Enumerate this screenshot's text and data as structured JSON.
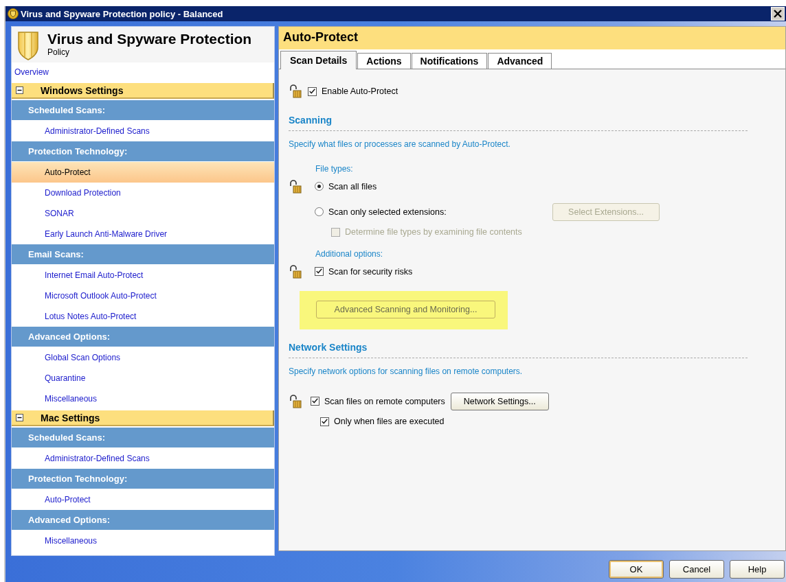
{
  "window": {
    "title": "Virus and Spyware Protection policy - Balanced"
  },
  "policy": {
    "title": "Virus and Spyware Protection",
    "subtitle": "Policy"
  },
  "sidebar": {
    "overview": "Overview",
    "groups": [
      {
        "label": "Windows Settings",
        "expanded": true,
        "sections": [
          {
            "label": "Scheduled Scans:",
            "items": [
              {
                "label": "Administrator-Defined Scans",
                "selected": false
              }
            ]
          },
          {
            "label": "Protection Technology:",
            "items": [
              {
                "label": "Auto-Protect",
                "selected": true
              },
              {
                "label": "Download Protection",
                "selected": false
              },
              {
                "label": "SONAR",
                "selected": false
              },
              {
                "label": "Early Launch Anti-Malware Driver",
                "selected": false
              }
            ]
          },
          {
            "label": "Email Scans:",
            "items": [
              {
                "label": "Internet Email Auto-Protect",
                "selected": false
              },
              {
                "label": "Microsoft Outlook Auto-Protect",
                "selected": false
              },
              {
                "label": "Lotus Notes Auto-Protect",
                "selected": false
              }
            ]
          },
          {
            "label": "Advanced Options:",
            "items": [
              {
                "label": "Global Scan Options",
                "selected": false
              },
              {
                "label": "Quarantine",
                "selected": false
              },
              {
                "label": "Miscellaneous",
                "selected": false
              }
            ]
          }
        ]
      },
      {
        "label": "Mac Settings",
        "expanded": true,
        "sections": [
          {
            "label": "Scheduled Scans:",
            "items": [
              {
                "label": "Administrator-Defined Scans",
                "selected": false
              }
            ]
          },
          {
            "label": "Protection Technology:",
            "items": [
              {
                "label": "Auto-Protect",
                "selected": false
              }
            ]
          },
          {
            "label": "Advanced Options:",
            "items": [
              {
                "label": "Miscellaneous",
                "selected": false
              }
            ]
          }
        ]
      }
    ]
  },
  "panel": {
    "title": "Auto-Protect",
    "tabs": [
      {
        "label": "Scan Details",
        "selected": true
      },
      {
        "label": "Actions",
        "selected": false
      },
      {
        "label": "Notifications",
        "selected": false
      },
      {
        "label": "Advanced",
        "selected": false
      }
    ],
    "enable": {
      "label": "Enable Auto-Protect",
      "checked": true,
      "lock": true
    },
    "sections": [
      {
        "heading": "Scanning",
        "description": "Specify what files or processes are scanned by Auto-Protect.",
        "groups": [
          {
            "label": "File types:",
            "options": [
              {
                "kind": "radio",
                "label": "Scan all files",
                "selected": true,
                "lock": true
              },
              {
                "kind": "radio",
                "label": "Scan only selected extensions:",
                "selected": false,
                "lock": false,
                "button": {
                  "label": "Select Extensions...",
                  "disabled": true
                },
                "children": [
                  {
                    "label": "Determine file types by examining file contents",
                    "checked": false,
                    "disabled": true
                  }
                ]
              }
            ]
          },
          {
            "label": "Additional options:",
            "options": [
              {
                "kind": "checkbox",
                "label": "Scan for security risks",
                "checked": true,
                "lock": true
              }
            ]
          }
        ],
        "action": {
          "label": "Advanced Scanning and Monitoring...",
          "highlighted": true
        }
      },
      {
        "heading": "Network Settings",
        "description": "Specify network options for scanning files on remote computers.",
        "groups": [
          {
            "options": [
              {
                "kind": "checkbox",
                "label": "Scan files on remote computers",
                "checked": true,
                "lock": true,
                "button": {
                  "label": "Network Settings...",
                  "disabled": false
                },
                "children": [
                  {
                    "label": "Only when files are executed",
                    "checked": true,
                    "disabled": false
                  }
                ]
              }
            ]
          }
        ]
      }
    ]
  },
  "buttons": [
    {
      "label": "OK",
      "default": true
    },
    {
      "label": "Cancel",
      "default": false
    },
    {
      "label": "Help",
      "default": false
    }
  ]
}
